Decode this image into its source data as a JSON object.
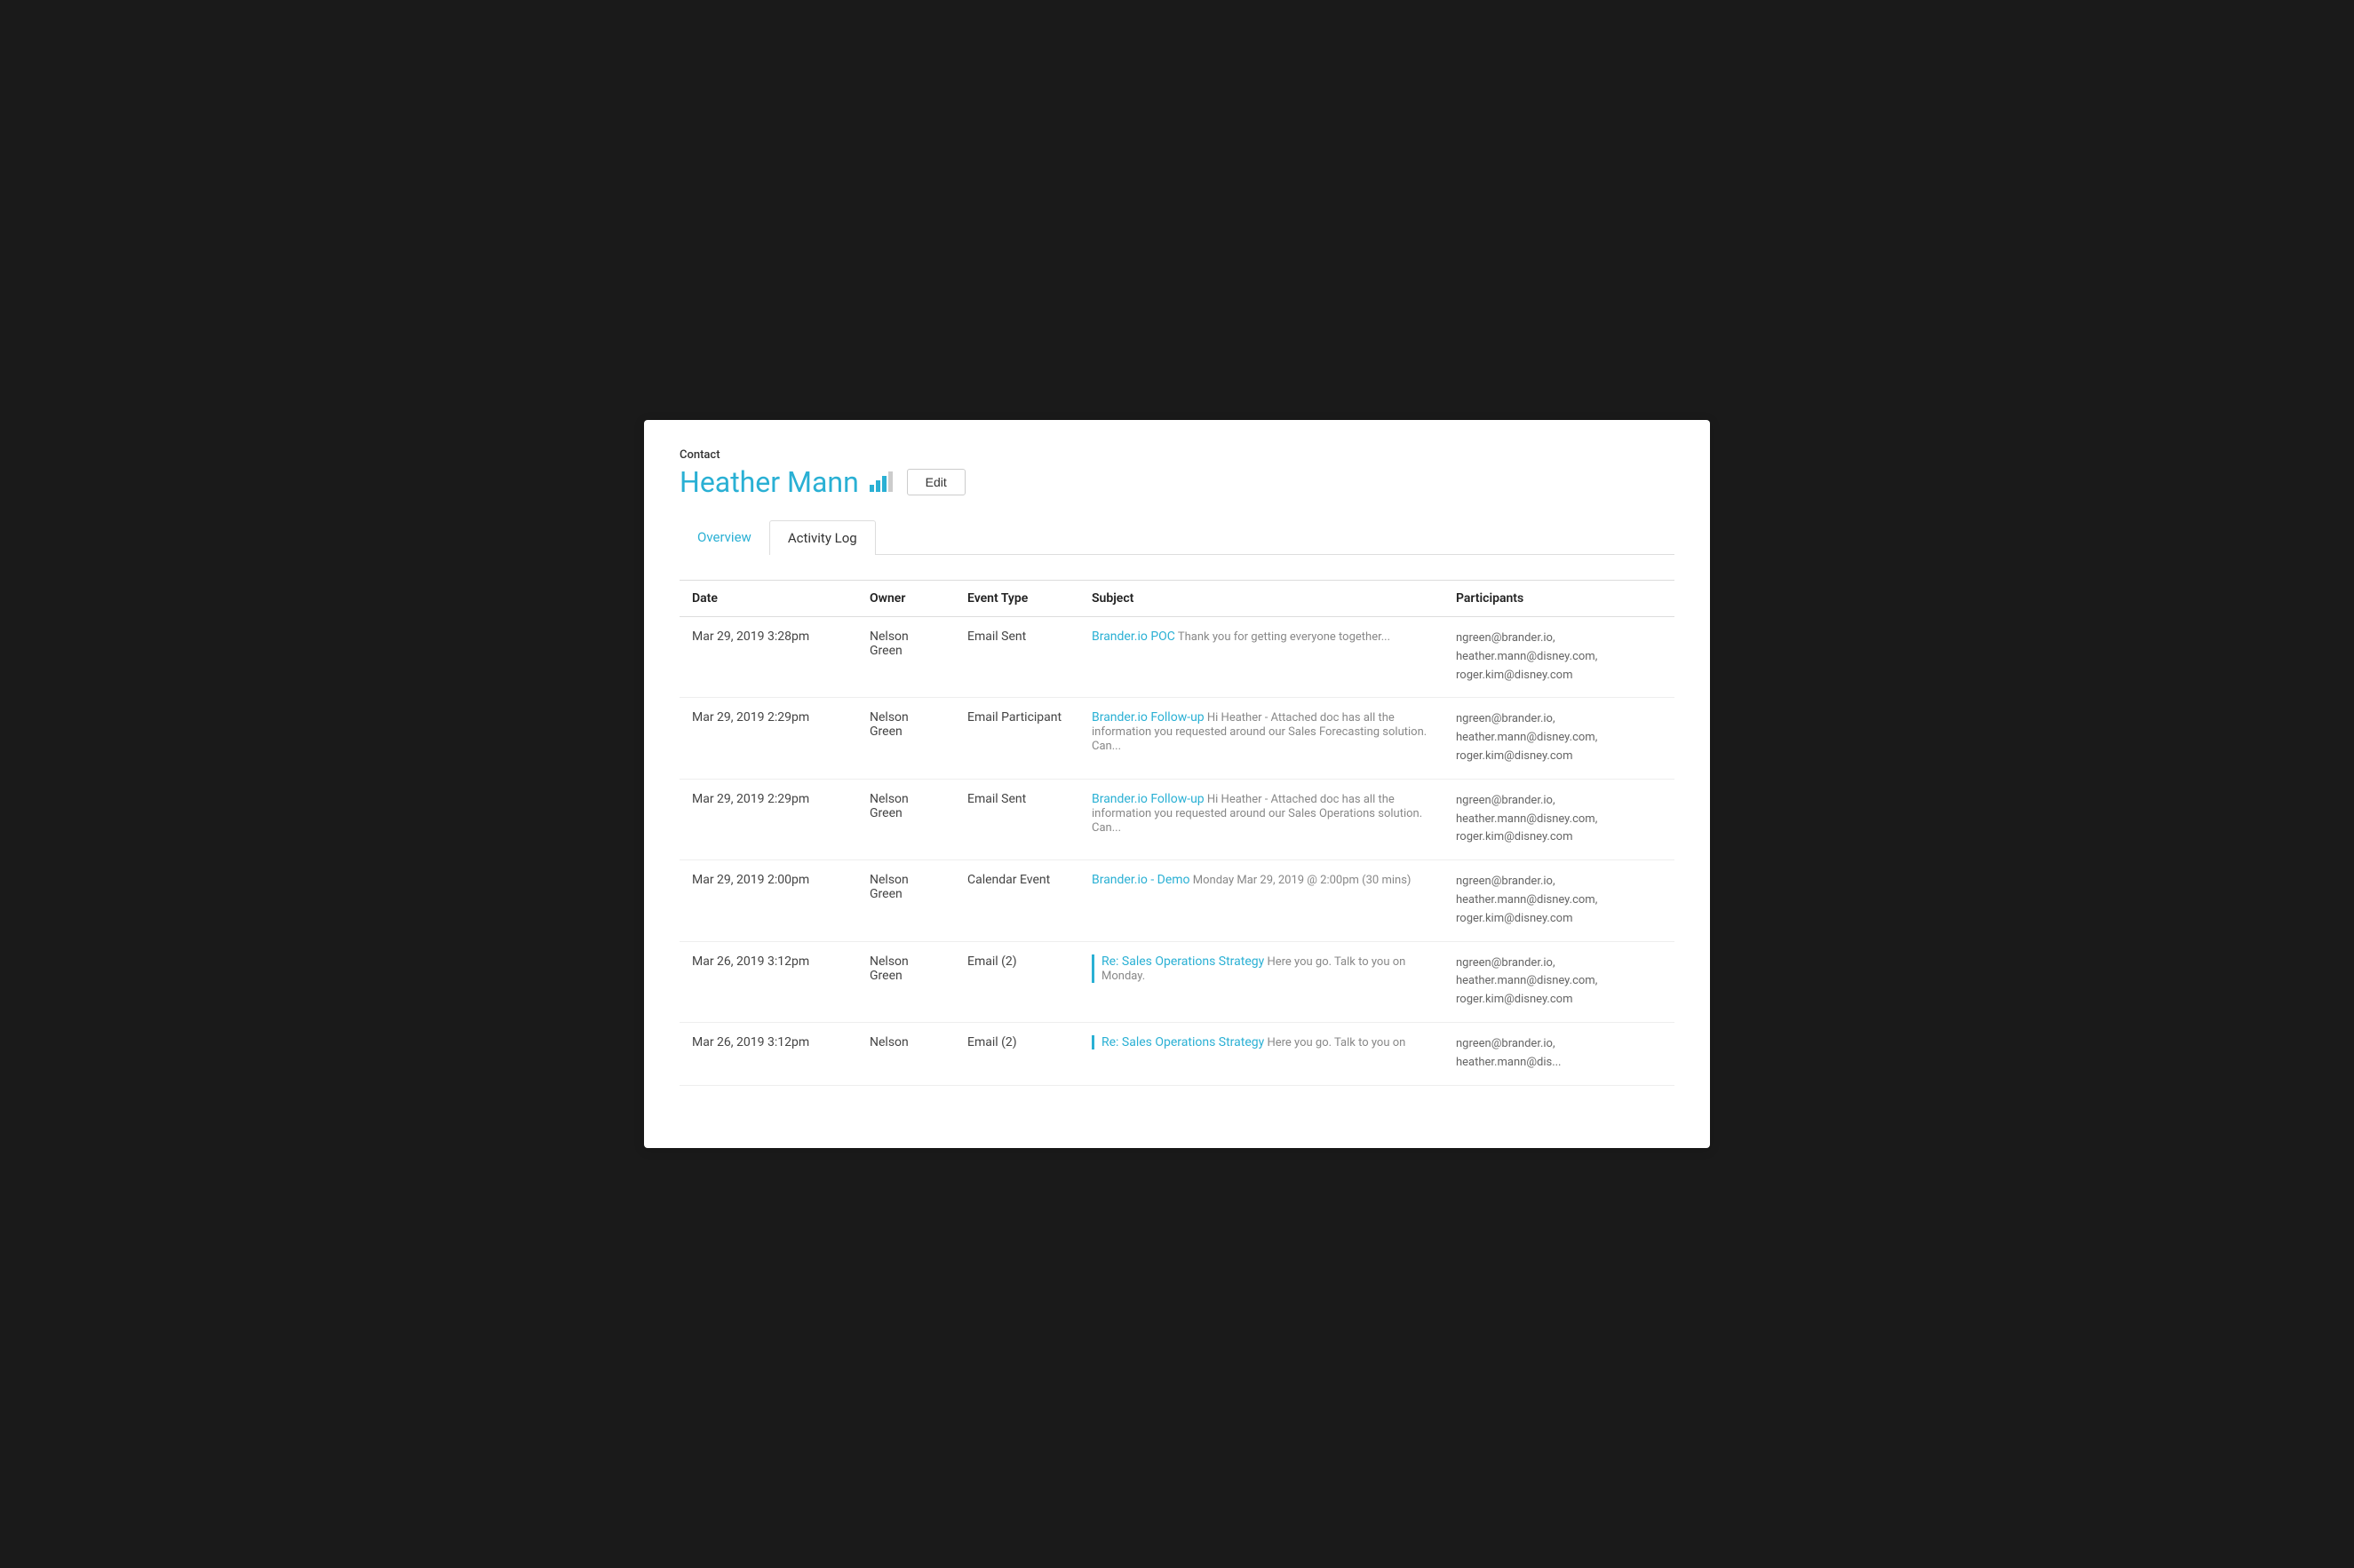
{
  "header": {
    "contact_label": "Contact",
    "contact_name": "Heather Mann",
    "edit_label": "Edit"
  },
  "tabs": [
    {
      "id": "overview",
      "label": "Overview",
      "active": false
    },
    {
      "id": "activity-log",
      "label": "Activity Log",
      "active": true
    }
  ],
  "table": {
    "columns": [
      "Date",
      "Owner",
      "Event Type",
      "Subject",
      "Participants"
    ],
    "rows": [
      {
        "date": "Mar 29, 2019 3:28pm",
        "owner": "Nelson Green",
        "event_type": "Email Sent",
        "subject_link": "Brander.io POC",
        "subject_text": " Thank you for getting everyone together...",
        "has_bar": false,
        "participants": "ngreen@brander.io, heather.mann@disney.com, roger.kim@disney.com"
      },
      {
        "date": "Mar 29, 2019 2:29pm",
        "owner": "Nelson Green",
        "event_type": "Email Participant",
        "subject_link": "Brander.io Follow-up",
        "subject_text": " Hi Heather - Attached doc has all the information you requested around our Sales Forecasting solution. Can...",
        "has_bar": false,
        "participants": "ngreen@brander.io, heather.mann@disney.com, roger.kim@disney.com"
      },
      {
        "date": "Mar 29, 2019 2:29pm",
        "owner": "Nelson Green",
        "event_type": "Email Sent",
        "subject_link": "Brander.io Follow-up",
        "subject_text": " Hi Heather - Attached doc has all the information you requested around our Sales Operations solution. Can...",
        "has_bar": false,
        "participants": "ngreen@brander.io, heather.mann@disney.com, roger.kim@disney.com"
      },
      {
        "date": "Mar 29, 2019 2:00pm",
        "owner": "Nelson Green",
        "event_type": "Calendar Event",
        "subject_link": "Brander.io - Demo",
        "subject_text": " Monday Mar 29, 2019 @ 2:00pm (30 mins)",
        "has_bar": false,
        "participants": "ngreen@brander.io, heather.mann@disney.com, roger.kim@disney.com"
      },
      {
        "date": "Mar 26, 2019 3:12pm",
        "owner": "Nelson Green",
        "event_type": "Email (2)",
        "subject_link": "Re: Sales Operations Strategy",
        "subject_text": " Here you go. Talk to you on Monday.",
        "has_bar": true,
        "participants": "ngreen@brander.io, heather.mann@disney.com, roger.kim@disney.com"
      },
      {
        "date": "Mar 26, 2019 3:12pm",
        "owner": "Nelson",
        "event_type": "Email (2)",
        "subject_link": "Re: Sales Operations Strategy",
        "subject_text": " Here you go. Talk to you on",
        "has_bar": true,
        "participants": "ngreen@brander.io, heather.mann@dis..."
      }
    ]
  }
}
